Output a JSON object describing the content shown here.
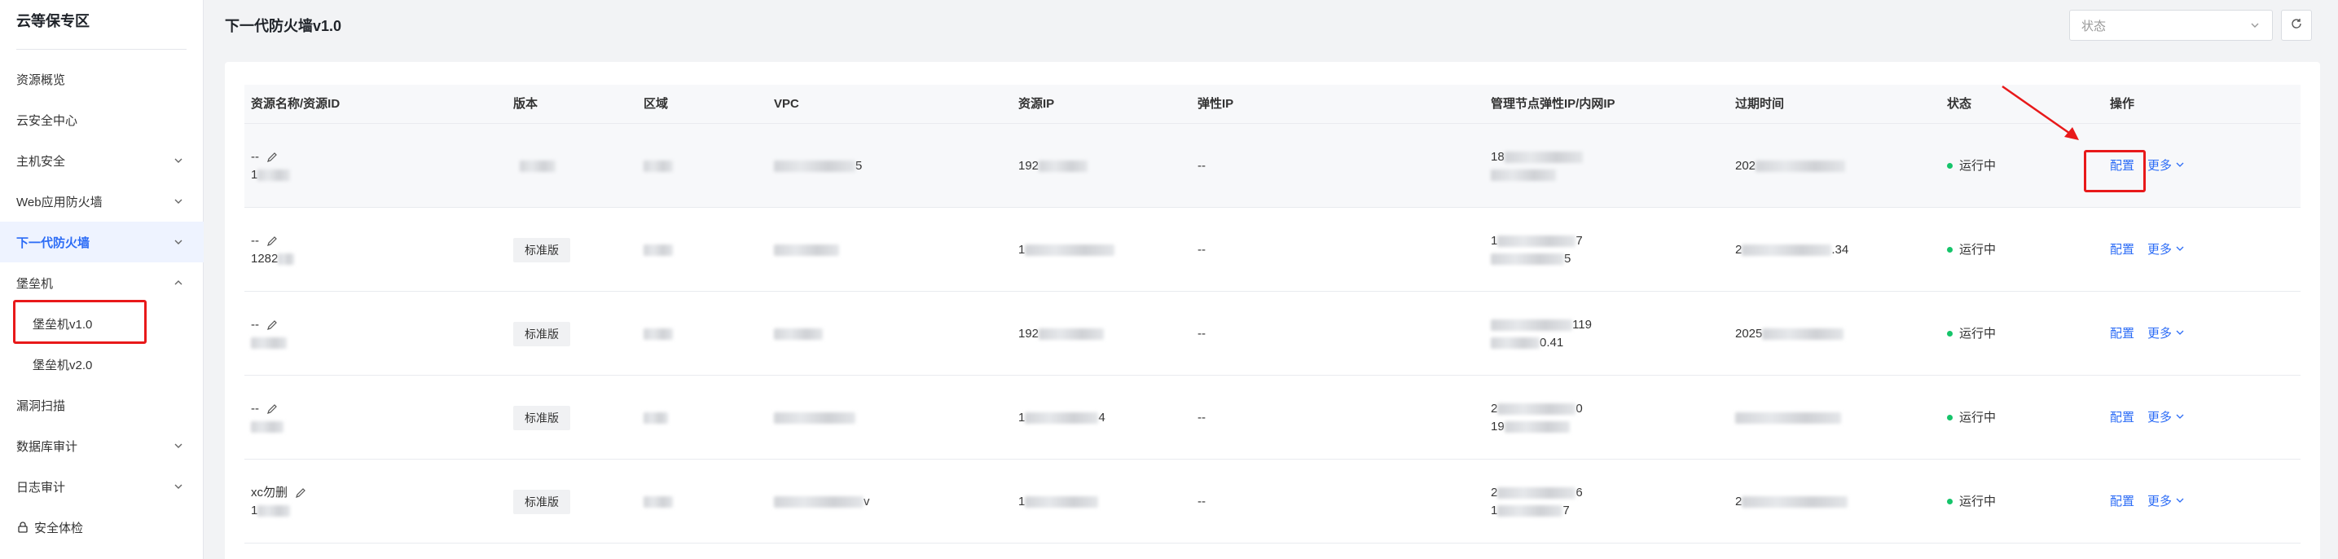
{
  "sidebar": {
    "title": "云等保专区",
    "items": [
      {
        "label": "资源概览",
        "chevron": ""
      },
      {
        "label": "云安全中心",
        "chevron": ""
      },
      {
        "label": "主机安全",
        "chevron": "down"
      },
      {
        "label": "Web应用防火墙",
        "chevron": "down"
      },
      {
        "label": "下一代防火墙",
        "chevron": "down"
      },
      {
        "label": "堡垒机",
        "chevron": "up"
      },
      {
        "label": "堡垒机v1.0",
        "chevron": ""
      },
      {
        "label": "堡垒机v2.0",
        "chevron": ""
      },
      {
        "label": "漏洞扫描",
        "chevron": ""
      },
      {
        "label": "数据库审计",
        "chevron": "down"
      },
      {
        "label": "日志审计",
        "chevron": "down"
      },
      {
        "label": "安全体检",
        "chevron": ""
      }
    ]
  },
  "header": {
    "title": "下一代防火墙v1.0",
    "status_placeholder": "状态"
  },
  "table": {
    "columns": [
      "资源名称/资源ID",
      "版本",
      "区域",
      "VPC",
      "资源IP",
      "弹性IP",
      "管理节点弹性IP/内网IP",
      "过期时间",
      "状态",
      "操作"
    ],
    "rows": [
      {
        "name": "--",
        "id_visible": "1",
        "version": "",
        "elastic_ip": "--",
        "status": "运行中",
        "ip_partial": "192",
        "mgmt_partial": [
          "18",
          ""
        ],
        "expire_partial": "202",
        "vpc_partial": "5"
      },
      {
        "name": "--",
        "id_visible": "1282",
        "version": "标准版",
        "elastic_ip": "--",
        "status": "运行中",
        "ip_partial": "1",
        "mgmt_partial": [
          "1",
          "5"
        ],
        "expire_partial": "2",
        "vpc_partial": "",
        "mgmt_tail": "7",
        "expire_tail": ".34"
      },
      {
        "name": "--",
        "id_visible": "",
        "version": "标准版",
        "elastic_ip": "--",
        "status": "运行中",
        "ip_partial": "192",
        "mgmt_partial": [
          "119",
          "0.41"
        ],
        "expire_partial": "2025",
        "vpc_partial": ""
      },
      {
        "name": "--",
        "id_visible": "",
        "version": "标准版",
        "elastic_ip": "--",
        "status": "运行中",
        "ip_partial": "1",
        "mgmt_partial": [
          "2",
          "19"
        ],
        "expire_partial": "",
        "vpc_partial": "",
        "ip_tail": "4",
        "mgmt_tail": "0"
      },
      {
        "name": "xc勿删",
        "id_visible": "1",
        "version": "标准版",
        "elastic_ip": "--",
        "status": "运行中",
        "ip_partial": "1",
        "mgmt_partial": [
          "2",
          "1"
        ],
        "expire_partial": "2",
        "vpc_partial": "",
        "vpc_tail": "v",
        "mgmt_tail": "6",
        "mgmt_tail2": "7"
      }
    ],
    "op_config": "配置",
    "op_more": "更多"
  },
  "colors": {
    "accent": "#2c6cf6",
    "running": "#15c46a",
    "annotation": "#e8191a"
  },
  "icons": [
    "edit-icon",
    "chevron-down-icon",
    "chevron-up-icon",
    "refresh-icon",
    "lock-icon"
  ]
}
